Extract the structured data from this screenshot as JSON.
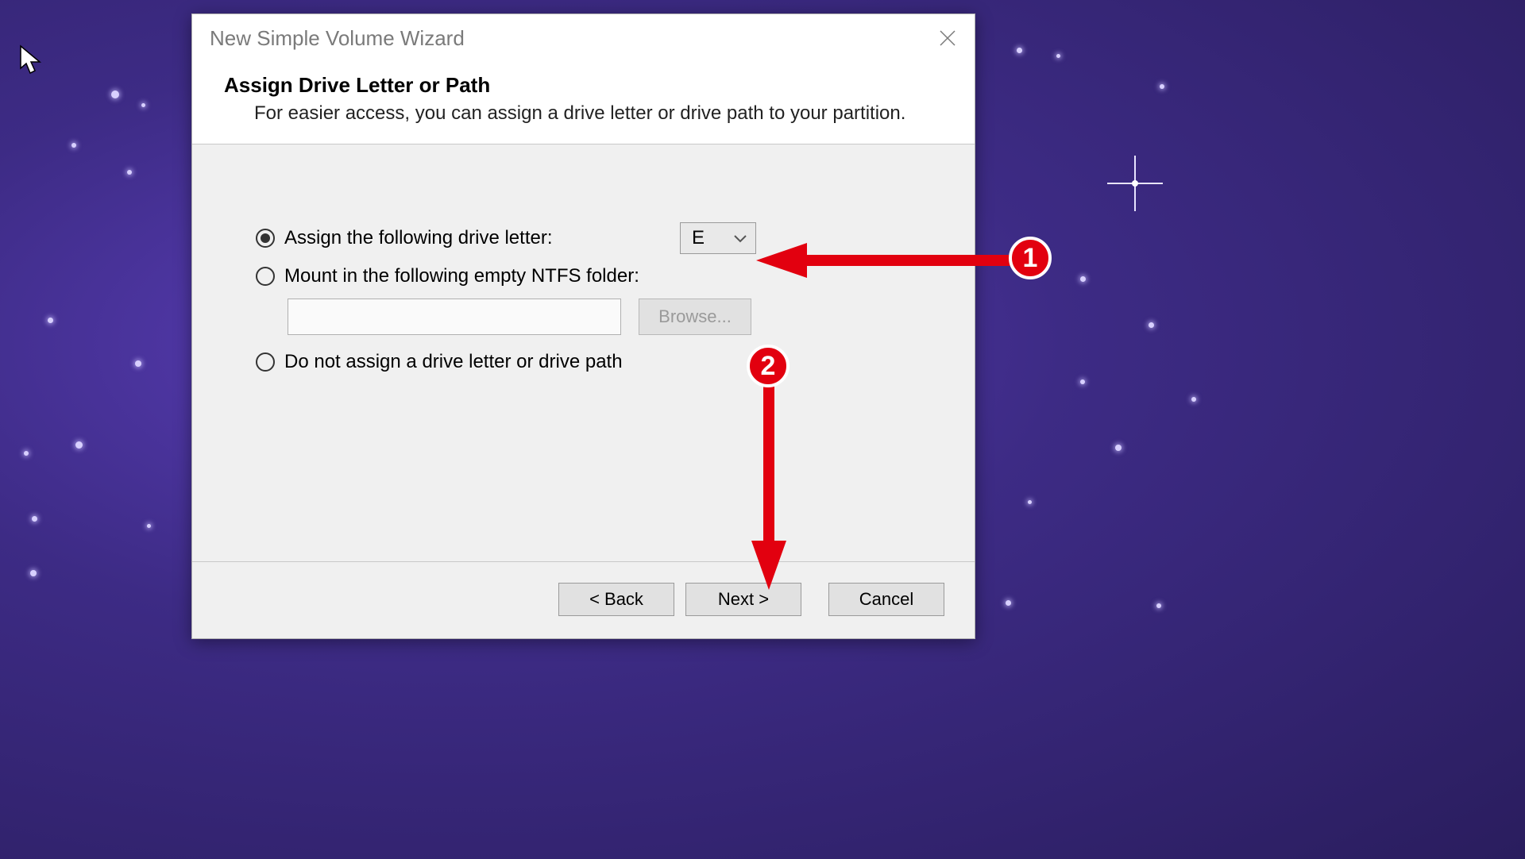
{
  "dialog": {
    "title": "New Simple Volume Wizard",
    "heading": "Assign Drive Letter or Path",
    "subheading": "For easier access, you can assign a drive letter or drive path to your partition.",
    "options": {
      "assign_letter": {
        "label": "Assign the following drive letter:",
        "checked": true,
        "selected_value": "E"
      },
      "mount_folder": {
        "label": "Mount in the following empty NTFS folder:",
        "checked": false,
        "path_value": "",
        "browse_label": "Browse..."
      },
      "no_assign": {
        "label": "Do not assign a drive letter or drive path",
        "checked": false
      }
    },
    "buttons": {
      "back": "< Back",
      "next": "Next >",
      "cancel": "Cancel"
    }
  },
  "annotations": {
    "badge1": "1",
    "badge2": "2"
  }
}
